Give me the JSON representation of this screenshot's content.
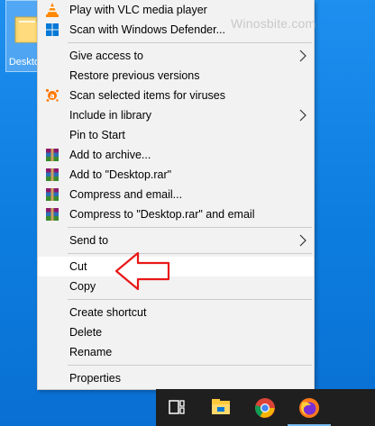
{
  "desktop": {
    "icon_label": "Desktop",
    "watermark": "Winosbite.com"
  },
  "context_menu": {
    "items": [
      {
        "label": "Play with VLC media player",
        "icon": "vlc-icon"
      },
      {
        "label": "Scan with Windows Defender...",
        "icon": "windows-defender-icon"
      },
      {
        "label": "Give access to",
        "submenu": true
      },
      {
        "label": "Restore previous versions"
      },
      {
        "label": "Scan selected items for viruses",
        "icon": "avast-icon"
      },
      {
        "label": "Include in library",
        "submenu": true
      },
      {
        "label": "Pin to Start"
      },
      {
        "label": "Add to archive...",
        "icon": "winrar-icon"
      },
      {
        "label": "Add to \"Desktop.rar\"",
        "icon": "winrar-icon"
      },
      {
        "label": "Compress and email...",
        "icon": "winrar-icon"
      },
      {
        "label": "Compress to \"Desktop.rar\" and email",
        "icon": "winrar-icon"
      },
      {
        "label": "Send to",
        "submenu": true
      },
      {
        "label": "Cut",
        "highlighted": true
      },
      {
        "label": "Copy"
      },
      {
        "label": "Create shortcut"
      },
      {
        "label": "Delete"
      },
      {
        "label": "Rename"
      },
      {
        "label": "Properties"
      }
    ]
  },
  "annotation": {
    "type": "red-arrow",
    "target": "Cut",
    "color": "#e81818"
  },
  "taskbar": {
    "items": [
      {
        "name": "task-view-icon"
      },
      {
        "name": "file-explorer-icon"
      },
      {
        "name": "chrome-icon"
      },
      {
        "name": "firefox-icon"
      }
    ]
  },
  "colors": {
    "desktop": "#0c7ddf",
    "menu_bg": "#f2f2f2",
    "highlight": "#ffffff",
    "taskbar": "#1f1f1f",
    "arrow": "#e81818"
  }
}
